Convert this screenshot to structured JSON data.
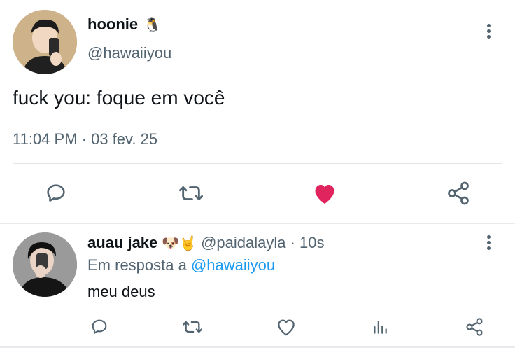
{
  "tweet": {
    "author_name": "hoonie",
    "author_emoji": "🐧",
    "handle": "@hawaiiyou",
    "text": "fuck you: foque em você",
    "timestamp": "11:04 PM · 03 fev. 25",
    "liked": true,
    "icons": [
      "reply-icon",
      "retweet-icon",
      "heart-filled-icon",
      "share-icon",
      "more-icon"
    ],
    "colors": {
      "like": "#e0245e",
      "icon": "#536471"
    }
  },
  "reply": {
    "author_name": "auau jake",
    "author_emoji": "🐶🤘",
    "handle_time": "@paidalayla · 10s",
    "reply_prefix": "Em resposta a",
    "reply_mention": "@hawaiiyou",
    "text": "meu deus",
    "icons": [
      "reply-icon",
      "retweet-icon",
      "heart-icon",
      "stats-icon",
      "share-icon",
      "more-icon"
    ],
    "colors": {
      "mention": "#1d9bf0"
    }
  }
}
